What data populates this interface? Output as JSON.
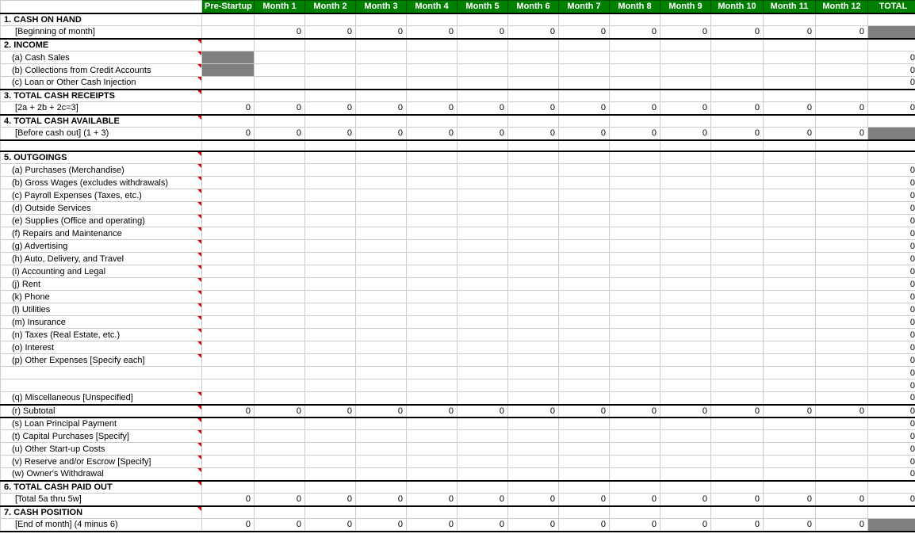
{
  "headers": [
    "Pre-Startup",
    "Month 1",
    "Month 2",
    "Month 3",
    "Month 4",
    "Month 5",
    "Month 6",
    "Month 7",
    "Month 8",
    "Month 9",
    "Month 10",
    "Month 11",
    "Month 12",
    "TOTAL"
  ],
  "rows": [
    {
      "label": "1. CASH ON HAND",
      "bold": true,
      "indent": 0,
      "mark": false,
      "vals": [
        "",
        "",
        "",
        "",
        "",
        "",
        "",
        "",
        "",
        "",
        "",
        "",
        "",
        ""
      ],
      "topBorder": true
    },
    {
      "label": "[Beginning of month]",
      "bold": false,
      "indent": 2,
      "mark": false,
      "vals": [
        "",
        "0",
        "0",
        "0",
        "0",
        "0",
        "0",
        "0",
        "0",
        "0",
        "0",
        "0",
        "0",
        ""
      ],
      "greyTotal": true,
      "botBorder": true
    },
    {
      "label": "2. INCOME",
      "bold": true,
      "indent": 0,
      "mark": true,
      "vals": [
        "",
        "",
        "",
        "",
        "",
        "",
        "",
        "",
        "",
        "",
        "",
        "",
        "",
        ""
      ]
    },
    {
      "label": "(a) Cash Sales",
      "bold": false,
      "indent": 1,
      "mark": true,
      "vals": [
        "",
        "",
        "",
        "",
        "",
        "",
        "",
        "",
        "",
        "",
        "",
        "",
        "",
        "0"
      ],
      "greyPre": true
    },
    {
      "label": "(b) Collections from Credit Accounts",
      "bold": false,
      "indent": 1,
      "mark": true,
      "vals": [
        "",
        "",
        "",
        "",
        "",
        "",
        "",
        "",
        "",
        "",
        "",
        "",
        "",
        "0"
      ],
      "greyPre": true
    },
    {
      "label": "(c) Loan or Other Cash Injection",
      "bold": false,
      "indent": 1,
      "mark": true,
      "vals": [
        "",
        "",
        "",
        "",
        "",
        "",
        "",
        "",
        "",
        "",
        "",
        "",
        "",
        "0"
      ],
      "botBorder": true
    },
    {
      "label": "3. TOTAL CASH RECEIPTS",
      "bold": true,
      "indent": 0,
      "mark": true,
      "vals": [
        "",
        "",
        "",
        "",
        "",
        "",
        "",
        "",
        "",
        "",
        "",
        "",
        "",
        ""
      ]
    },
    {
      "label": "[2a + 2b + 2c=3]",
      "bold": false,
      "indent": 2,
      "mark": false,
      "vals": [
        "0",
        "0",
        "0",
        "0",
        "0",
        "0",
        "0",
        "0",
        "0",
        "0",
        "0",
        "0",
        "0",
        "0"
      ],
      "botBorder": true
    },
    {
      "label": "4. TOTAL CASH AVAILABLE",
      "bold": true,
      "indent": 0,
      "mark": true,
      "vals": [
        "",
        "",
        "",
        "",
        "",
        "",
        "",
        "",
        "",
        "",
        "",
        "",
        "",
        ""
      ]
    },
    {
      "label": "[Before cash out] (1 + 3)",
      "bold": false,
      "indent": 2,
      "mark": false,
      "vals": [
        "0",
        "0",
        "0",
        "0",
        "0",
        "0",
        "0",
        "0",
        "0",
        "0",
        "0",
        "0",
        "0",
        ""
      ],
      "greyTotal": true,
      "botBorder": true
    },
    {
      "label": "",
      "bold": false,
      "indent": 0,
      "mark": false,
      "vals": [
        "",
        "",
        "",
        "",
        "",
        "",
        "",
        "",
        "",
        "",
        "",
        "",
        "",
        ""
      ],
      "blank": true
    },
    {
      "label": "5. OUTGOINGS",
      "bold": true,
      "indent": 0,
      "mark": true,
      "vals": [
        "",
        "",
        "",
        "",
        "",
        "",
        "",
        "",
        "",
        "",
        "",
        "",
        "",
        ""
      ],
      "topBorder": true
    },
    {
      "label": "(a) Purchases (Merchandise)",
      "bold": false,
      "indent": 1,
      "mark": true,
      "vals": [
        "",
        "",
        "",
        "",
        "",
        "",
        "",
        "",
        "",
        "",
        "",
        "",
        "",
        "0"
      ]
    },
    {
      "label": "(b) Gross Wages (excludes withdrawals)",
      "bold": false,
      "indent": 1,
      "mark": true,
      "vals": [
        "",
        "",
        "",
        "",
        "",
        "",
        "",
        "",
        "",
        "",
        "",
        "",
        "",
        "0"
      ]
    },
    {
      "label": "(c) Payroll Expenses (Taxes, etc.)",
      "bold": false,
      "indent": 1,
      "mark": true,
      "vals": [
        "",
        "",
        "",
        "",
        "",
        "",
        "",
        "",
        "",
        "",
        "",
        "",
        "",
        "0"
      ]
    },
    {
      "label": "(d) Outside Services",
      "bold": false,
      "indent": 1,
      "mark": true,
      "vals": [
        "",
        "",
        "",
        "",
        "",
        "",
        "",
        "",
        "",
        "",
        "",
        "",
        "",
        "0"
      ]
    },
    {
      "label": "(e) Supplies (Office and operating)",
      "bold": false,
      "indent": 1,
      "mark": true,
      "vals": [
        "",
        "",
        "",
        "",
        "",
        "",
        "",
        "",
        "",
        "",
        "",
        "",
        "",
        "0"
      ]
    },
    {
      "label": "(f) Repairs and Maintenance",
      "bold": false,
      "indent": 1,
      "mark": true,
      "vals": [
        "",
        "",
        "",
        "",
        "",
        "",
        "",
        "",
        "",
        "",
        "",
        "",
        "",
        "0"
      ]
    },
    {
      "label": "(g) Advertising",
      "bold": false,
      "indent": 1,
      "mark": true,
      "vals": [
        "",
        "",
        "",
        "",
        "",
        "",
        "",
        "",
        "",
        "",
        "",
        "",
        "",
        "0"
      ]
    },
    {
      "label": "(h) Auto, Delivery, and Travel",
      "bold": false,
      "indent": 1,
      "mark": true,
      "vals": [
        "",
        "",
        "",
        "",
        "",
        "",
        "",
        "",
        "",
        "",
        "",
        "",
        "",
        "0"
      ]
    },
    {
      "label": "(i) Accounting and Legal",
      "bold": false,
      "indent": 1,
      "mark": true,
      "vals": [
        "",
        "",
        "",
        "",
        "",
        "",
        "",
        "",
        "",
        "",
        "",
        "",
        "",
        "0"
      ]
    },
    {
      "label": "(j) Rent",
      "bold": false,
      "indent": 1,
      "mark": true,
      "vals": [
        "",
        "",
        "",
        "",
        "",
        "",
        "",
        "",
        "",
        "",
        "",
        "",
        "",
        "0"
      ]
    },
    {
      "label": "(k) Phone",
      "bold": false,
      "indent": 1,
      "mark": true,
      "vals": [
        "",
        "",
        "",
        "",
        "",
        "",
        "",
        "",
        "",
        "",
        "",
        "",
        "",
        "0"
      ]
    },
    {
      "label": "(l) Utilities",
      "bold": false,
      "indent": 1,
      "mark": true,
      "vals": [
        "",
        "",
        "",
        "",
        "",
        "",
        "",
        "",
        "",
        "",
        "",
        "",
        "",
        "0"
      ]
    },
    {
      "label": "(m) Insurance",
      "bold": false,
      "indent": 1,
      "mark": true,
      "vals": [
        "",
        "",
        "",
        "",
        "",
        "",
        "",
        "",
        "",
        "",
        "",
        "",
        "",
        "0"
      ]
    },
    {
      "label": "(n) Taxes (Real Estate, etc.)",
      "bold": false,
      "indent": 1,
      "mark": true,
      "vals": [
        "",
        "",
        "",
        "",
        "",
        "",
        "",
        "",
        "",
        "",
        "",
        "",
        "",
        "0"
      ]
    },
    {
      "label": "(o) Interest",
      "bold": false,
      "indent": 1,
      "mark": true,
      "vals": [
        "",
        "",
        "",
        "",
        "",
        "",
        "",
        "",
        "",
        "",
        "",
        "",
        "",
        "0"
      ]
    },
    {
      "label": "(p) Other Expenses [Specify each]",
      "bold": false,
      "indent": 1,
      "mark": true,
      "vals": [
        "",
        "",
        "",
        "",
        "",
        "",
        "",
        "",
        "",
        "",
        "",
        "",
        "",
        "0"
      ]
    },
    {
      "label": "",
      "bold": false,
      "indent": 1,
      "mark": false,
      "vals": [
        "",
        "",
        "",
        "",
        "",
        "",
        "",
        "",
        "",
        "",
        "",
        "",
        "",
        "0"
      ]
    },
    {
      "label": "",
      "bold": false,
      "indent": 1,
      "mark": false,
      "vals": [
        "",
        "",
        "",
        "",
        "",
        "",
        "",
        "",
        "",
        "",
        "",
        "",
        "",
        "0"
      ]
    },
    {
      "label": "(q) Miscellaneous [Unspecified]",
      "bold": false,
      "indent": 1,
      "mark": true,
      "vals": [
        "",
        "",
        "",
        "",
        "",
        "",
        "",
        "",
        "",
        "",
        "",
        "",
        "",
        "0"
      ],
      "botBorder": true
    },
    {
      "label": "(r) Subtotal",
      "bold": false,
      "indent": 1,
      "mark": true,
      "vals": [
        "0",
        "0",
        "0",
        "0",
        "0",
        "0",
        "0",
        "0",
        "0",
        "0",
        "0",
        "0",
        "0",
        "0"
      ],
      "botBorder": true
    },
    {
      "label": "(s) Loan Principal Payment",
      "bold": false,
      "indent": 1,
      "mark": true,
      "vals": [
        "",
        "",
        "",
        "",
        "",
        "",
        "",
        "",
        "",
        "",
        "",
        "",
        "",
        "0"
      ]
    },
    {
      "label": "(t) Capital Purchases [Specify]",
      "bold": false,
      "indent": 1,
      "mark": true,
      "vals": [
        "",
        "",
        "",
        "",
        "",
        "",
        "",
        "",
        "",
        "",
        "",
        "",
        "",
        "0"
      ]
    },
    {
      "label": "(u) Other Start-up Costs",
      "bold": false,
      "indent": 1,
      "mark": true,
      "vals": [
        "",
        "",
        "",
        "",
        "",
        "",
        "",
        "",
        "",
        "",
        "",
        "",
        "",
        "0"
      ]
    },
    {
      "label": "(v) Reserve and/or Escrow [Specify]",
      "bold": false,
      "indent": 1,
      "mark": true,
      "vals": [
        "",
        "",
        "",
        "",
        "",
        "",
        "",
        "",
        "",
        "",
        "",
        "",
        "",
        "0"
      ]
    },
    {
      "label": "(w) Owner's Withdrawal",
      "bold": false,
      "indent": 1,
      "mark": true,
      "vals": [
        "",
        "",
        "",
        "",
        "",
        "",
        "",
        "",
        "",
        "",
        "",
        "",
        "",
        "0"
      ],
      "botBorder": true
    },
    {
      "label": "6. TOTAL CASH PAID OUT",
      "bold": true,
      "indent": 0,
      "mark": true,
      "vals": [
        "",
        "",
        "",
        "",
        "",
        "",
        "",
        "",
        "",
        "",
        "",
        "",
        "",
        ""
      ]
    },
    {
      "label": "[Total 5a thru 5w]",
      "bold": false,
      "indent": 2,
      "mark": false,
      "vals": [
        "0",
        "0",
        "0",
        "0",
        "0",
        "0",
        "0",
        "0",
        "0",
        "0",
        "0",
        "0",
        "0",
        "0"
      ],
      "botBorder": true
    },
    {
      "label": "7. CASH POSITION",
      "bold": true,
      "indent": 0,
      "mark": true,
      "vals": [
        "",
        "",
        "",
        "",
        "",
        "",
        "",
        "",
        "",
        "",
        "",
        "",
        "",
        ""
      ]
    },
    {
      "label": "[End of month]  (4 minus 6)",
      "bold": false,
      "indent": 2,
      "mark": false,
      "vals": [
        "0",
        "0",
        "0",
        "0",
        "0",
        "0",
        "0",
        "0",
        "0",
        "0",
        "0",
        "0",
        "0",
        ""
      ],
      "greyTotal": true,
      "botBorder": true
    }
  ]
}
